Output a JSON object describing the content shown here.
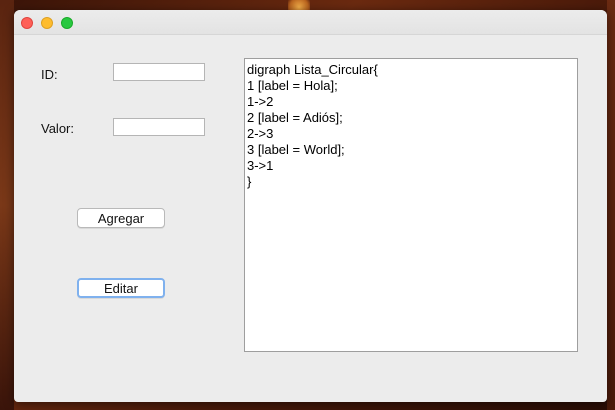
{
  "form": {
    "id_label": "ID:",
    "id_value": "",
    "valor_label": "Valor:",
    "valor_value": "",
    "add_button": "Agregar",
    "edit_button": "Editar"
  },
  "output": {
    "lines": [
      "digraph Lista_Circular{",
      "1 [label = Hola];",
      "1->2",
      "2 [label = Adiós];",
      "2->3",
      "3 [label = World];",
      "3->1",
      "}"
    ]
  }
}
